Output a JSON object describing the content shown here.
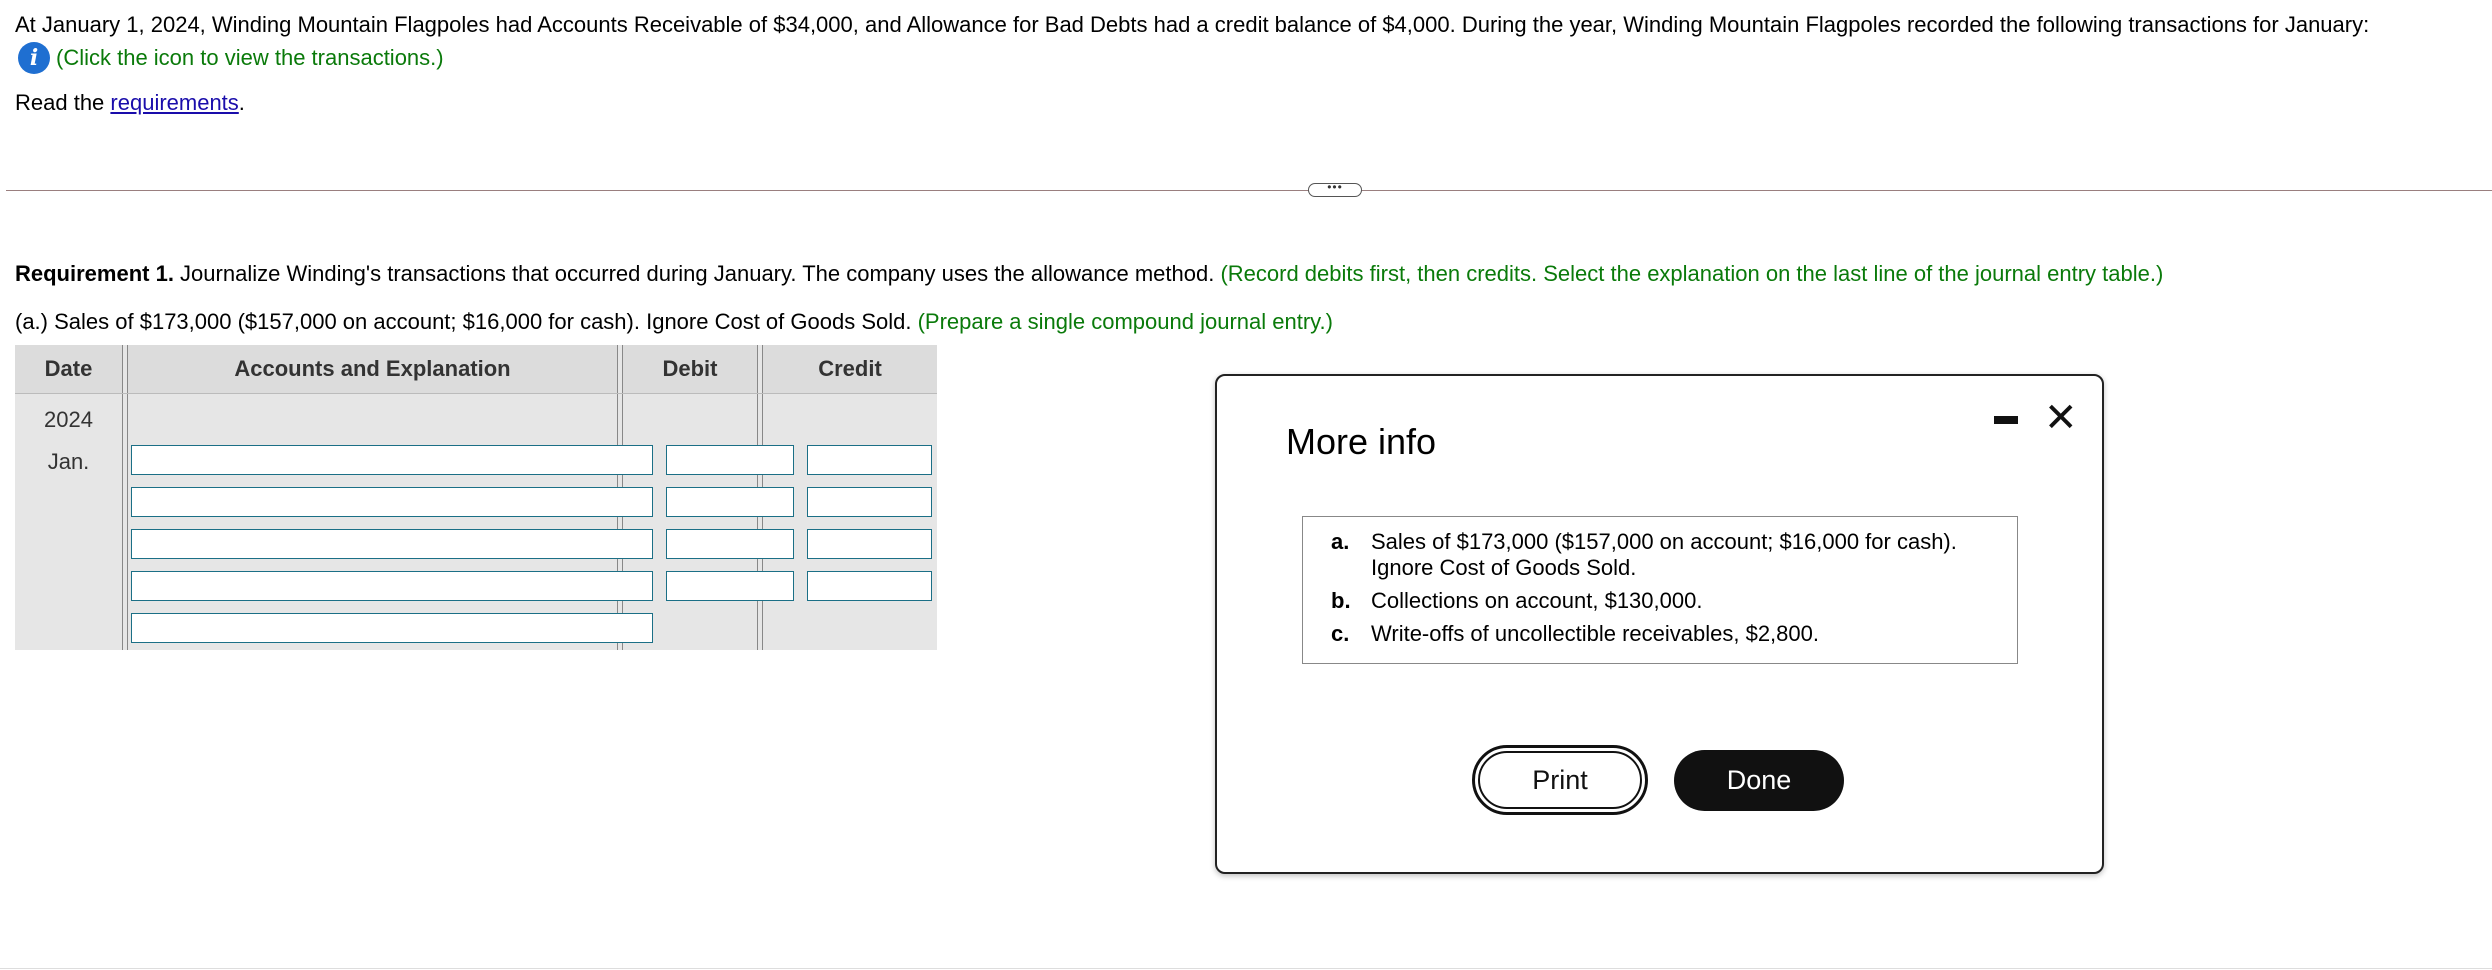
{
  "intro": "At January 1, 2024, Winding Mountain Flagpoles had Accounts Receivable of $34,000, and Allowance for Bad Debts had a credit balance of $4,000. During the year, Winding Mountain Flagpoles recorded the following transactions for January:",
  "click_hint": "(Click the icon to view the transactions.)",
  "read_prefix": "Read the ",
  "requirements_link": "requirements",
  "read_suffix": ".",
  "more_pill": "•••",
  "req1": {
    "label": "Requirement 1.",
    "text": " Journalize Winding's transactions that occurred during January. The company uses the allowance method. ",
    "hint": "(Record debits first, then credits. Select the explanation on the last line of the journal entry table.)"
  },
  "part_a": {
    "text": "(a.) Sales of $173,000 ($157,000 on account; $16,000 for cash). Ignore Cost of Goods Sold. ",
    "hint": "(Prepare a single compound journal entry.)"
  },
  "journal": {
    "headers": {
      "date": "Date",
      "accounts": "Accounts and Explanation",
      "debit": "Debit",
      "credit": "Credit"
    },
    "year": "2024",
    "month": "Jan."
  },
  "modal": {
    "title": "More info",
    "transactions": [
      {
        "letter": "a.",
        "line1": "Sales of $173,000 ($157,000 on account; $16,000 for cash).",
        "line2": "Ignore Cost of Goods Sold."
      },
      {
        "letter": "b.",
        "line1": "Collections on account, $130,000."
      },
      {
        "letter": "c.",
        "line1": "Write-offs of uncollectible receivables, $2,800."
      }
    ],
    "print_label": "Print",
    "done_label": "Done"
  },
  "colors": {
    "hint_green": "#0a7a0a",
    "link_blue": "#1a0dab",
    "info_icon": "#1f6fd1",
    "input_border": "#1b6f86"
  }
}
